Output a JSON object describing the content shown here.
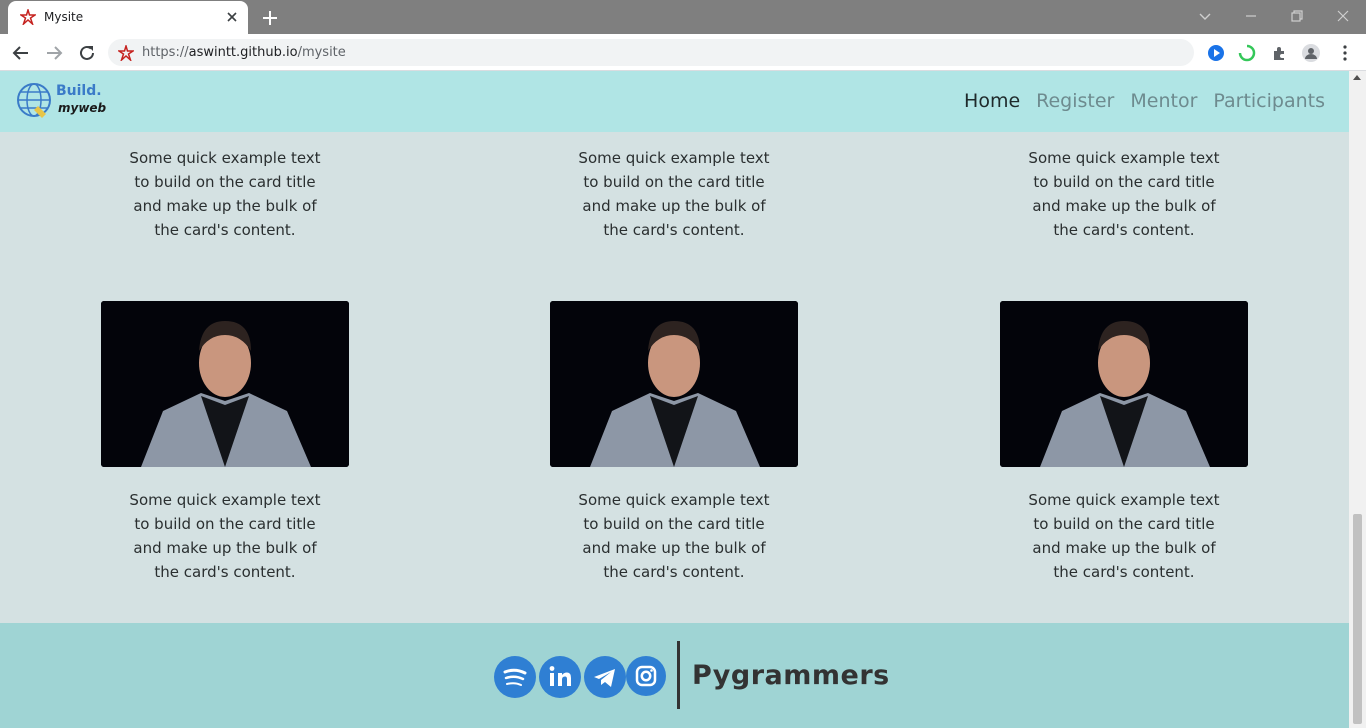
{
  "browser": {
    "tab_title": "Mysite",
    "url_scheme": "https://",
    "url_host": "aswintt.github.io",
    "url_path": "/mysite"
  },
  "navbar": {
    "brand_line1": "Build.",
    "brand_line2": "myweb",
    "links": [
      {
        "label": "Home",
        "active": true
      },
      {
        "label": "Register",
        "active": false
      },
      {
        "label": "Mentor",
        "active": false
      },
      {
        "label": "Participants",
        "active": false
      }
    ]
  },
  "cards_top": [
    {
      "text": "Some quick example text to build on the card title and make up the bulk of the card's content."
    },
    {
      "text": "Some quick example text to build on the card title and make up the bulk of the card's content."
    },
    {
      "text": "Some quick example text to build on the card title and make up the bulk of the card's content."
    }
  ],
  "cards_bottom": [
    {
      "image": "person-photo",
      "text": "Some quick example text to build on the card title and make up the bulk of the card's content."
    },
    {
      "image": "person-photo",
      "text": "Some quick example text to build on the card title and make up the bulk of the card's content."
    },
    {
      "image": "person-photo",
      "text": "Some quick example text to build on the card title and make up the bulk of the card's content."
    }
  ],
  "footer": {
    "socials": [
      "spotify-icon",
      "linkedin-icon",
      "telegram-icon",
      "instagram-icon"
    ],
    "brand": "Pygrammers"
  },
  "colors": {
    "navbar_bg": "#b0e5e5",
    "page_bg": "#d4e1e2",
    "footer_bg": "#9fd4d4",
    "social_blue": "#2f7fd3"
  }
}
